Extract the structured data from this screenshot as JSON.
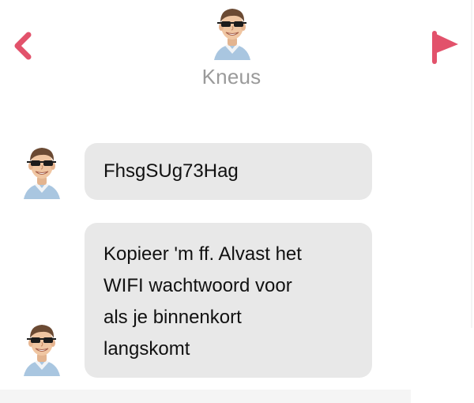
{
  "header": {
    "contact_name": "Kneus",
    "back_icon": "chevron-left-icon",
    "flag_icon": "flag-icon"
  },
  "messages": [
    {
      "text": "FhsgSUg73Hag"
    },
    {
      "lines": [
        "Kopieer 'm ff. Alvast het",
        "WIFI wachtwoord voor",
        "als je binnenkort",
        "langskomt"
      ]
    }
  ],
  "colors": {
    "accent": "#e2526b",
    "bubble": "#e8e8e8",
    "name_gray": "#9a9a9a"
  }
}
